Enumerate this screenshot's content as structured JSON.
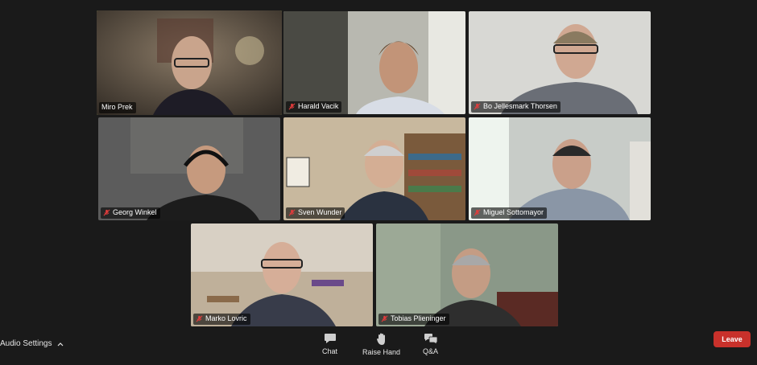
{
  "participants": [
    {
      "name": "Miro Prek",
      "muted": false
    },
    {
      "name": "Harald Vacik",
      "muted": true
    },
    {
      "name": "Bo Jellesmark Thorsen",
      "muted": true
    },
    {
      "name": "Georg Winkel",
      "muted": true
    },
    {
      "name": "Sven Wunder",
      "muted": true
    },
    {
      "name": "Miguel Sottomayor",
      "muted": true
    },
    {
      "name": "Marko Lovric",
      "muted": true
    },
    {
      "name": "Tobias Plieninger",
      "muted": true
    }
  ],
  "toolbar": {
    "audio_settings": "Audio Settings",
    "chat": "Chat",
    "raise_hand": "Raise Hand",
    "qa": "Q&A",
    "leave": "Leave"
  },
  "colors": {
    "active_speaker_border": "#c6e66a",
    "leave_button": "#c8312b",
    "mute_icon": "#e23c3c",
    "background": "#1a1a1a"
  },
  "icons": {
    "muted": "microphone-muted-icon",
    "chat": "chat-bubble-icon",
    "raise_hand": "hand-icon",
    "qa": "qa-bubbles-icon",
    "caret": "chevron-up-icon"
  }
}
